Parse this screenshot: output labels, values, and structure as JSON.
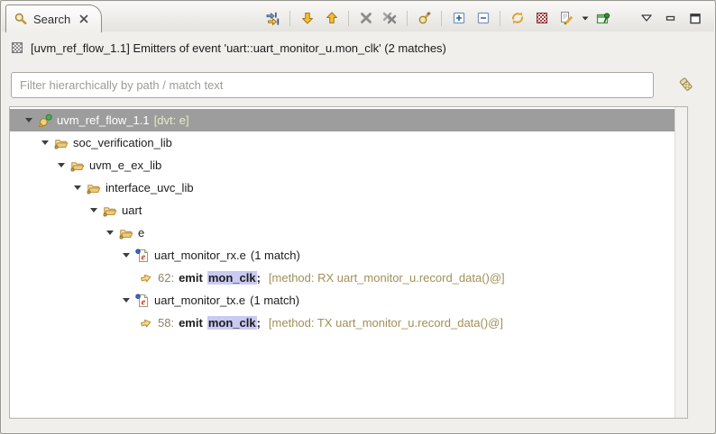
{
  "tab": {
    "label": "Search"
  },
  "toolbar": {
    "groups": [
      [
        "jump-to-location-icon"
      ],
      [
        "next-match-icon",
        "previous-match-icon"
      ],
      [
        "remove-selected-match-icon",
        "remove-all-matches-icon"
      ],
      [
        "run-search-again-icon"
      ],
      [
        "expand-all-icon",
        "collapse-all-icon"
      ],
      [
        "refresh-icon",
        "cancel-search-icon",
        "search-history-icon",
        "dropdown-arrow-icon",
        "pin-view-icon"
      ]
    ],
    "window_controls": [
      "view-menu-icon",
      "minimize-icon",
      "maximize-icon"
    ]
  },
  "header": {
    "icon": "search-results-icon",
    "text": "[uvm_ref_flow_1.1] Emitters of event 'uart::uart_monitor_u.mon_clk' (2 matches)"
  },
  "filter": {
    "placeholder": "Filter hierarchically by path / match text",
    "value": "",
    "clear_icon": "clear-filter-icon"
  },
  "tree": {
    "rows": [
      {
        "type": "root",
        "level": 0,
        "icon": "dvt-search-root-icon",
        "label": "uvm_ref_flow_1.1",
        "decoration": "[dvt: e]",
        "selected": true,
        "expanded": true
      },
      {
        "type": "folder",
        "level": 1,
        "icon": "folder-icon",
        "label": "soc_verification_lib",
        "expanded": true
      },
      {
        "type": "folder",
        "level": 2,
        "icon": "folder-icon",
        "label": "uvm_e_ex_lib",
        "expanded": true
      },
      {
        "type": "folder",
        "level": 3,
        "icon": "folder-icon",
        "label": "interface_uvc_lib",
        "expanded": true
      },
      {
        "type": "folder",
        "level": 4,
        "icon": "folder-icon",
        "label": "uart",
        "expanded": true
      },
      {
        "type": "folder",
        "level": 5,
        "icon": "folder-icon",
        "label": "e",
        "expanded": true
      },
      {
        "type": "efile",
        "level": 6,
        "icon": "e-file-icon",
        "label": "uart_monitor_rx.e",
        "count": "(1 match)",
        "expanded": true
      },
      {
        "type": "match",
        "level": 7,
        "icon": "match-arrow-icon",
        "line_number": "62:",
        "keyword": "emit",
        "event": "mon_clk",
        "suffix": ";",
        "context": "[method: RX uart_monitor_u.record_data()@]"
      },
      {
        "type": "efile",
        "level": 6,
        "icon": "e-file-icon",
        "label": "uart_monitor_tx.e",
        "count": "(1 match)",
        "expanded": true
      },
      {
        "type": "match",
        "level": 7,
        "icon": "match-arrow-icon",
        "line_number": "58:",
        "keyword": "emit",
        "event": "mon_clk",
        "suffix": ";",
        "context": "[method: TX uart_monitor_u.record_data()@]"
      }
    ]
  },
  "colors": {
    "selection_bg": "#9d9d9d",
    "match_highlight_bg": "#c9c9f2",
    "context_text": "#a18f58",
    "line_number_text": "#8e8468",
    "decoration_text": "#e4eec6",
    "toolbar_accent_gold": "#e9b13c"
  }
}
